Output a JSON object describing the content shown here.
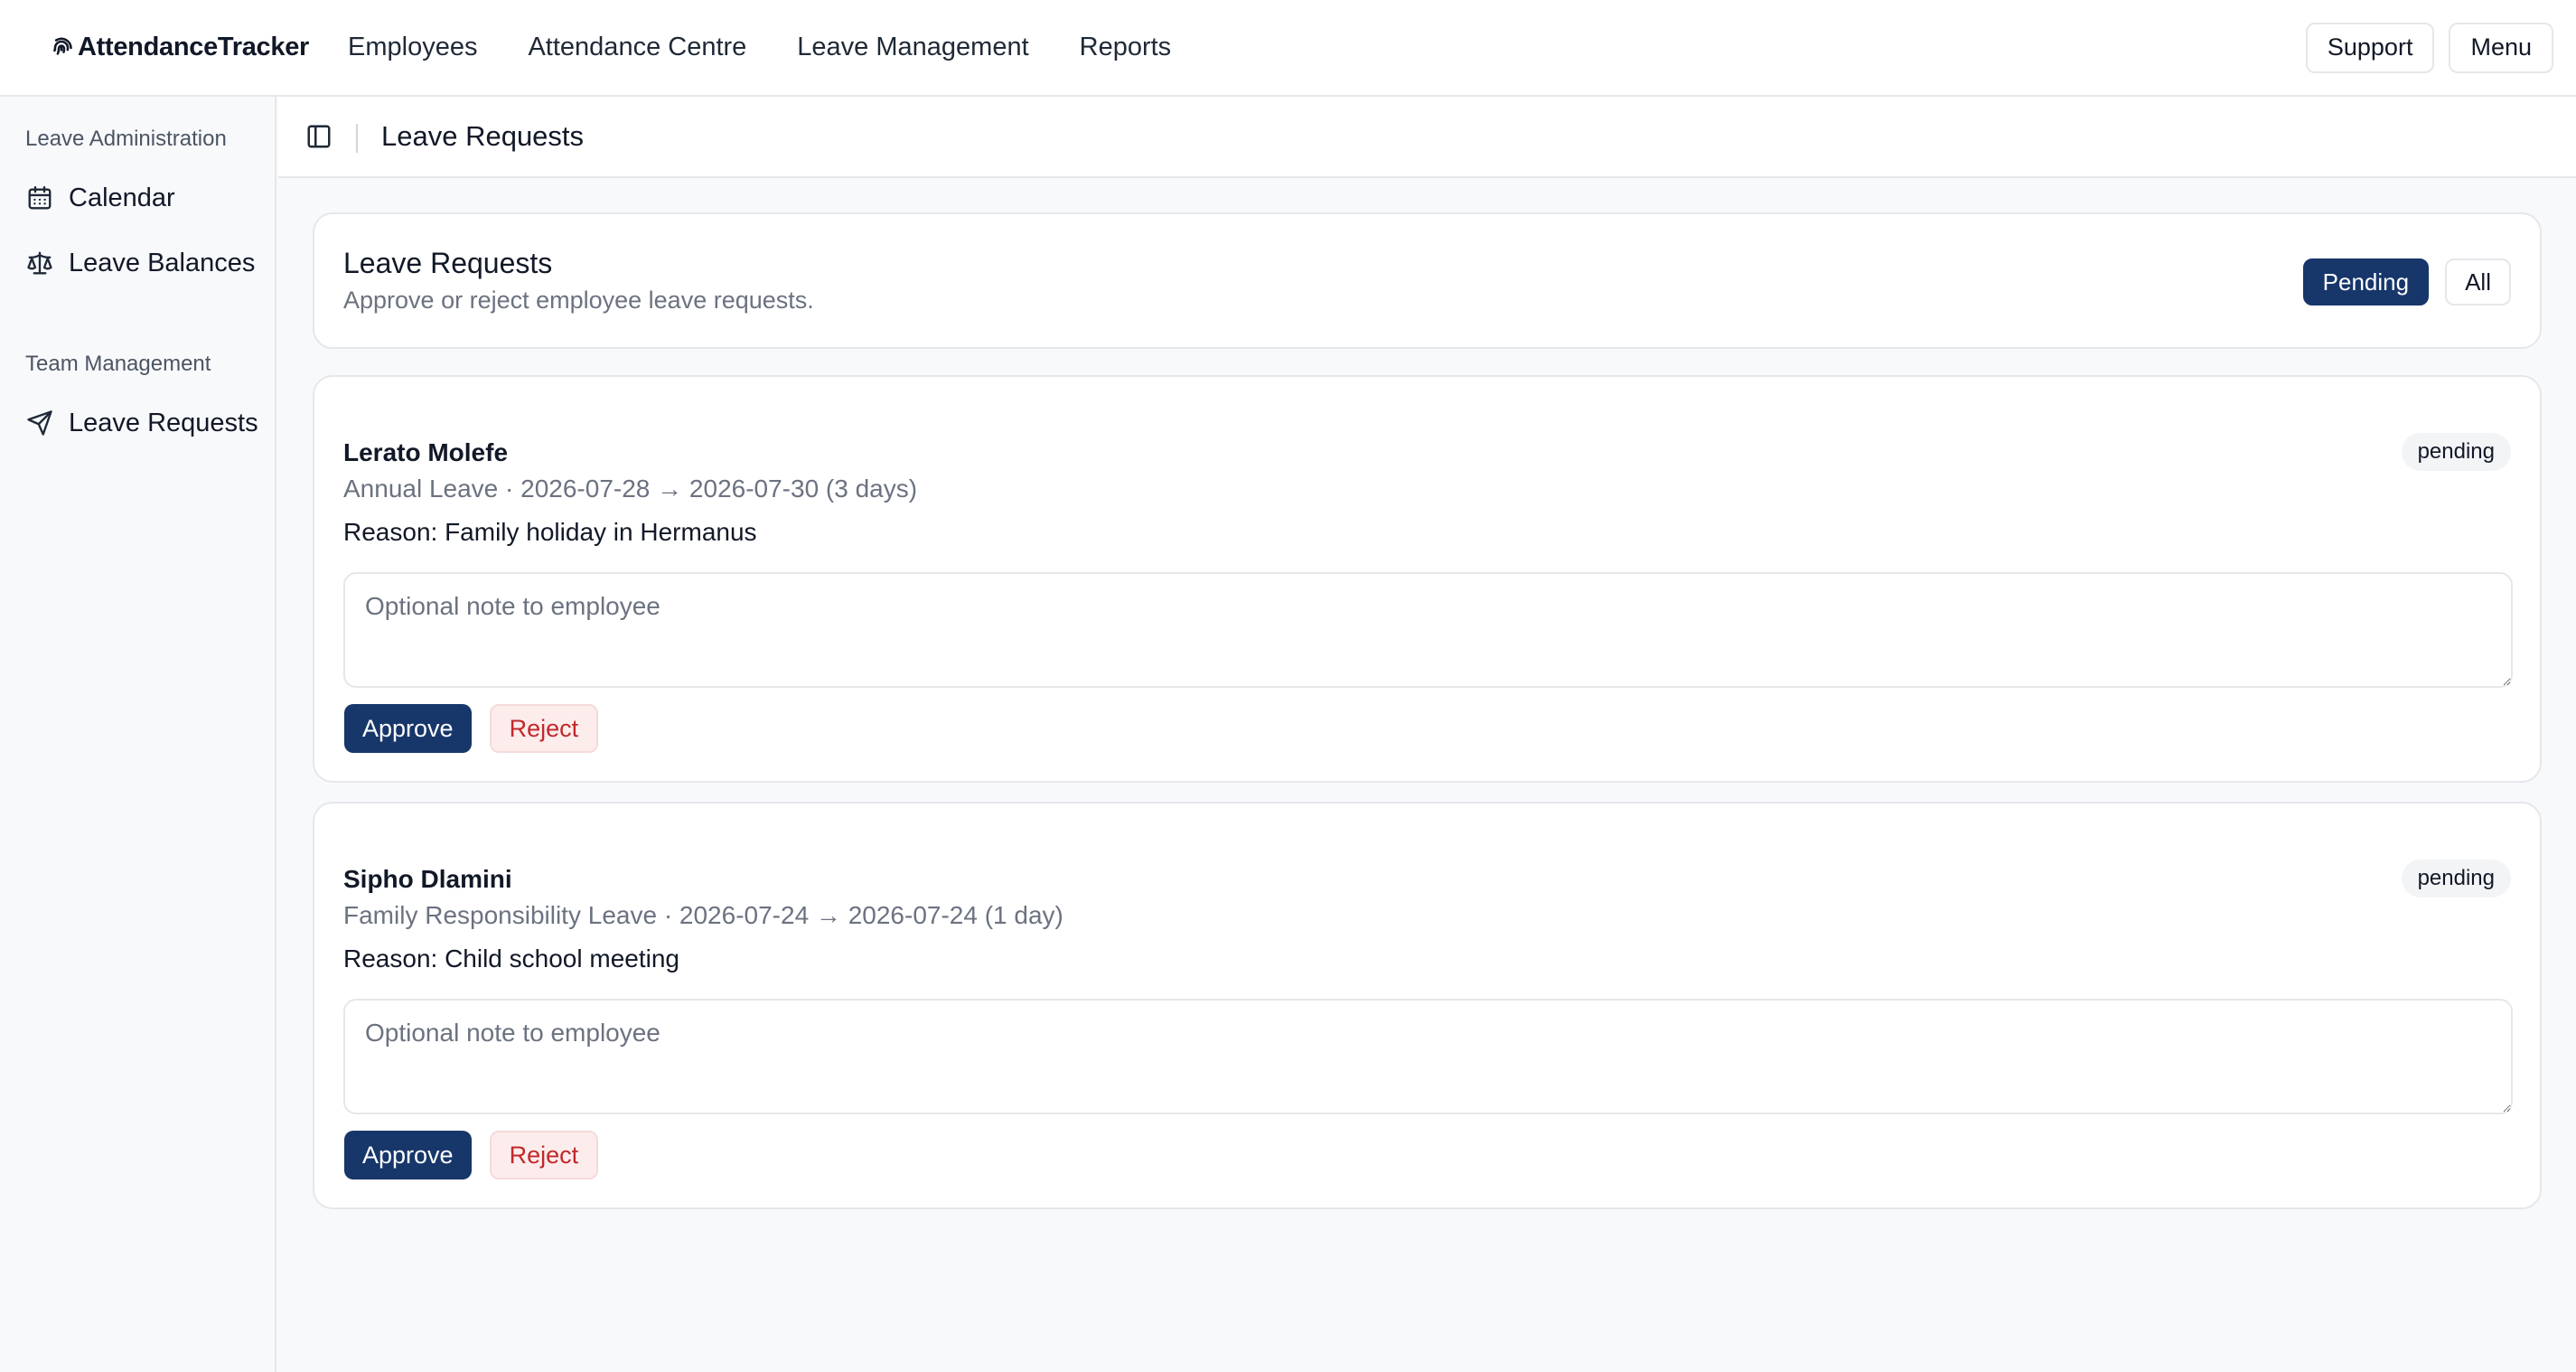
{
  "app": {
    "brand": "AttendanceTracker"
  },
  "nav": {
    "items": [
      "Employees",
      "Attendance Centre",
      "Leave Management",
      "Reports"
    ]
  },
  "top_actions": {
    "support": "Support",
    "menu": "Menu"
  },
  "sidebar": {
    "sections": [
      {
        "title": "Leave Administration",
        "items": [
          {
            "label": "Calendar",
            "icon": "calendar-icon"
          },
          {
            "label": "Leave Balances",
            "icon": "scale-icon"
          }
        ]
      },
      {
        "title": "Team Management",
        "items": [
          {
            "label": "Leave Requests",
            "icon": "send-icon"
          }
        ]
      }
    ]
  },
  "header": {
    "title": "Leave Requests"
  },
  "intro": {
    "title": "Leave Requests",
    "subtitle": "Approve or reject employee leave requests.",
    "filters": [
      {
        "label": "Pending",
        "active": true
      },
      {
        "label": "All",
        "active": false
      }
    ]
  },
  "requests": [
    {
      "name": "Lerato Molefe",
      "meta": "Annual Leave · 2026-07-28 → 2026-07-30 (3 days)",
      "reason": "Reason: Family holiday in Hermanus",
      "status": "pending",
      "note_value": "",
      "note_placeholder": "Optional note to employee",
      "approve_label": "Approve",
      "reject_label": "Reject"
    },
    {
      "name": "Sipho Dlamini",
      "meta": "Family Responsibility Leave · 2026-07-24 → 2026-07-24 (1 day)",
      "reason": "Reason: Child school meeting",
      "status": "pending",
      "note_value": "",
      "note_placeholder": "Optional note to employee",
      "approve_label": "Approve",
      "reject_label": "Reject"
    }
  ],
  "colors": {
    "primary": "#17366a",
    "reject_text": "#c0292b",
    "reject_bg": "#fdecec",
    "border": "#e5e7eb",
    "muted_text": "#6b7280",
    "page_bg": "#f8f9fb"
  }
}
